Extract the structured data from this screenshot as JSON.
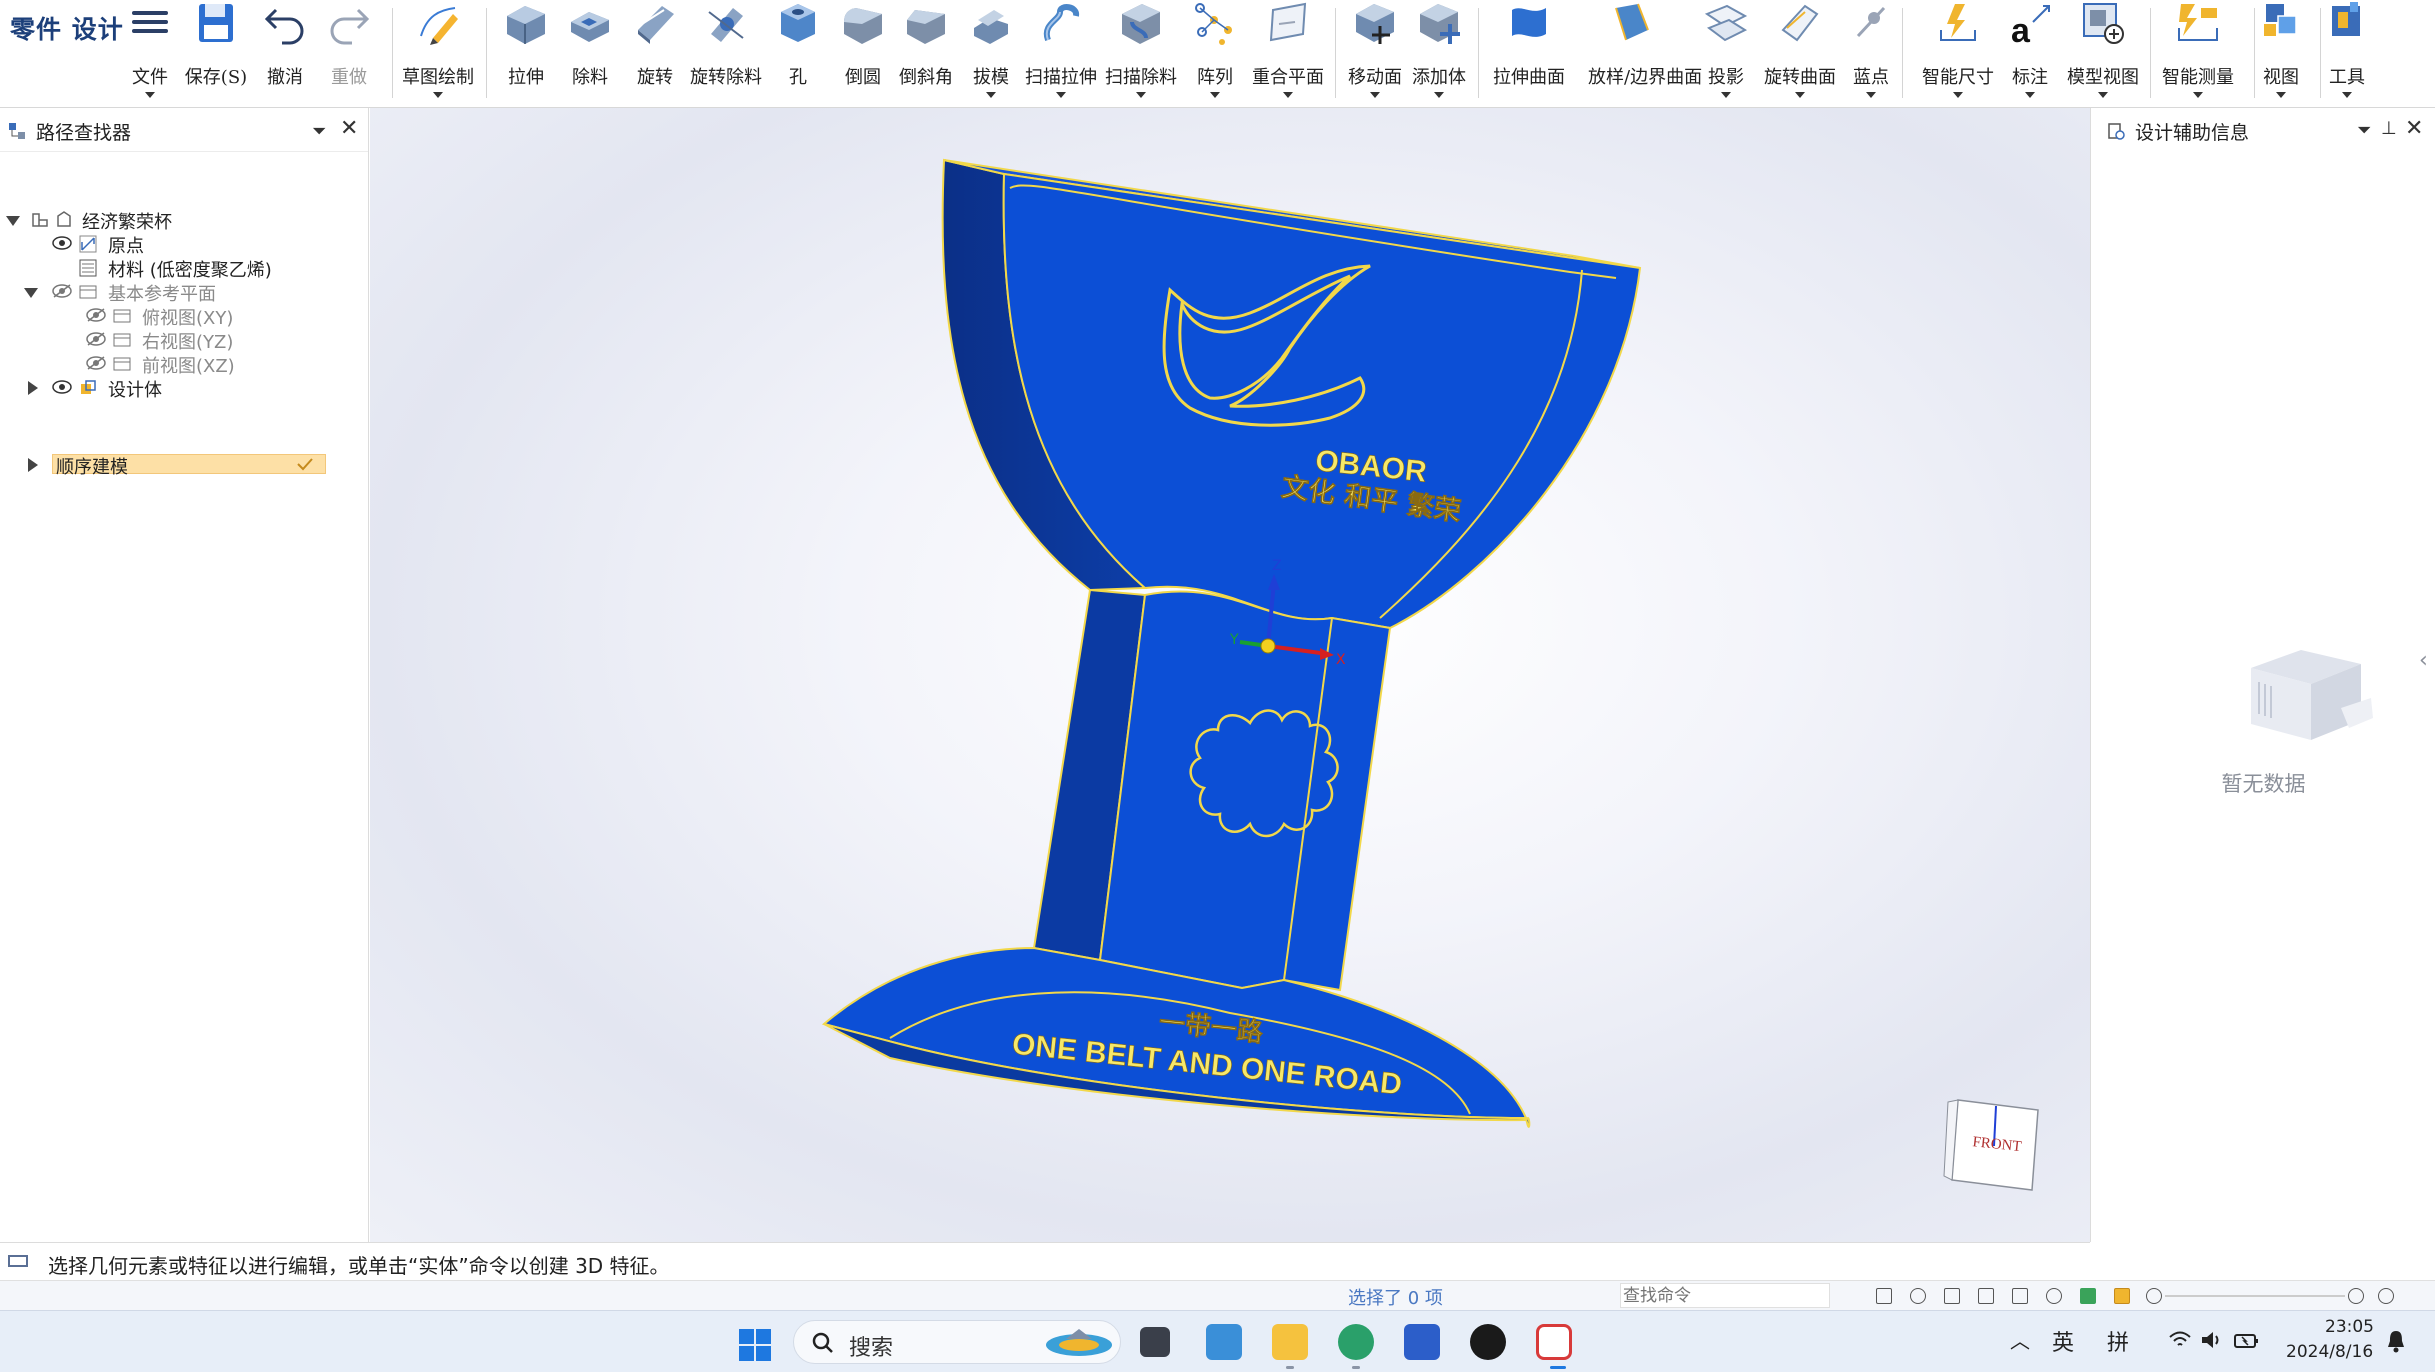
{
  "app": {
    "brand": "零件 设计"
  },
  "ribbon": {
    "file": "文件",
    "save": "保存(S)",
    "undo": "撤消",
    "redo": "重做",
    "sketch": "草图绘制",
    "extrude": "拉伸",
    "cut": "除料",
    "revolve": "旋转",
    "revolve_cut": "旋转除料",
    "hole": "孔",
    "fillet": "倒圆",
    "chamfer": "倒斜角",
    "draft": "拔模",
    "sweep": "扫描拉伸",
    "sweep_cut": "扫描除料",
    "pattern": "阵列",
    "coincident_plane": "重合平面",
    "move_face": "移动面",
    "add_body": "添加体",
    "extrude_surface": "拉伸曲面",
    "loft_surface": "放样/边界曲面",
    "project": "投影",
    "revolve_surface": "旋转曲面",
    "blue_point": "蓝点",
    "smart_dim": "智能尺寸",
    "annotate": "标注",
    "model_view": "模型视图",
    "smart_measure": "智能测量",
    "view": "视图",
    "tools": "工具"
  },
  "path_finder": {
    "title": "路径查找器",
    "items": [
      {
        "label": "经济繁荣杯"
      },
      {
        "label": "原点"
      },
      {
        "label": "材料 (低密度聚乙烯)"
      },
      {
        "label": "基本参考平面"
      },
      {
        "label": "俯视图(XY)"
      },
      {
        "label": "右视图(YZ)"
      },
      {
        "label": "前视图(XZ)"
      },
      {
        "label": "设计体"
      },
      {
        "label": "顺序建模"
      }
    ]
  },
  "model": {
    "text_top_1": "OBAOR",
    "text_top_2": "文化 和平  繁荣",
    "text_bottom_1": "一带一路",
    "text_bottom_2": "ONE BELT AND ONE ROAD",
    "body_color": "#0c4fd6",
    "edge_color": "#f2d84a",
    "axis_z": "Z",
    "axis_y": "Y",
    "axis_x": "X",
    "view_cube_label": "FRONT"
  },
  "design_info": {
    "title": "设计辅助信息",
    "empty": "暂无数据"
  },
  "prompt": {
    "text": "选择几何元素或特征以进行编辑，或单击“实体”命令以创建 3D 特征。"
  },
  "status": {
    "selected": "选择了 0 项",
    "search_placeholder": "查找命令"
  },
  "taskbar": {
    "search": "搜索",
    "ime_lang": "英",
    "ime_mode": "拼",
    "time": "23:05",
    "date": "2024/8/16"
  }
}
